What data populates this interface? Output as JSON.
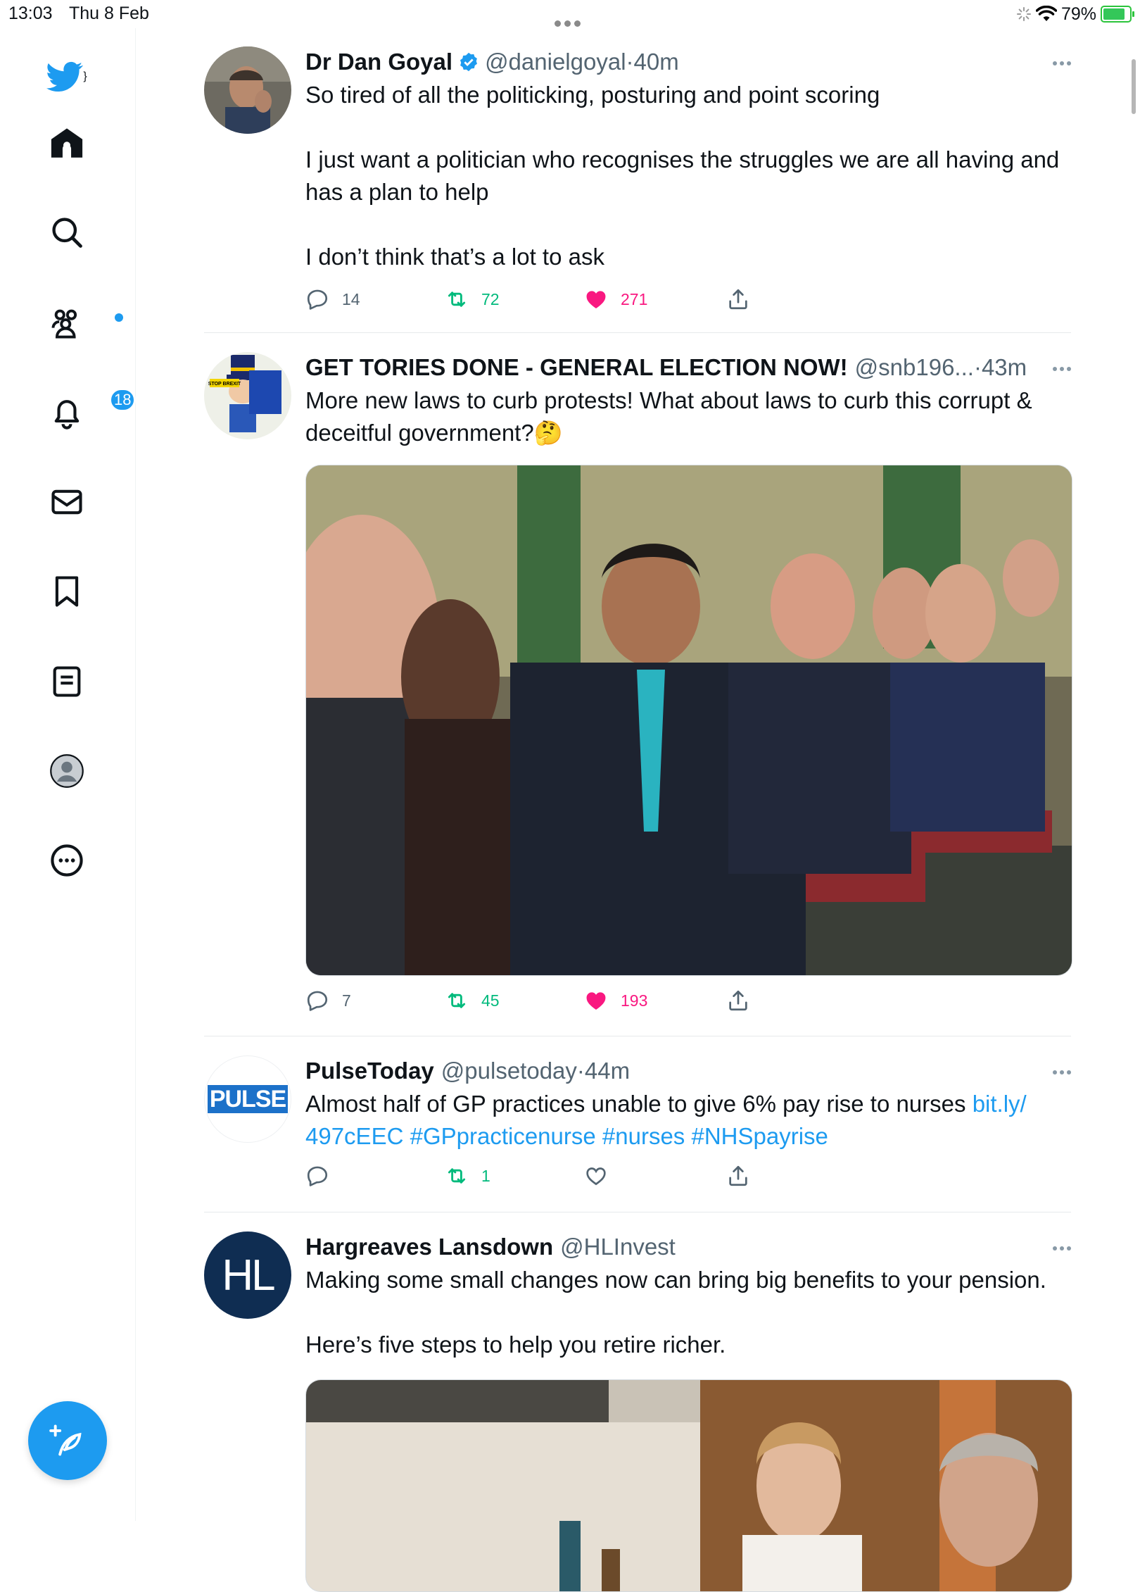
{
  "status_bar": {
    "time": "13:03",
    "date": "Thu 8 Feb",
    "battery": "79%"
  },
  "sidebar": {
    "items": [
      {
        "name": "home",
        "icon": "home-icon"
      },
      {
        "name": "explore",
        "icon": "search-icon"
      },
      {
        "name": "communities",
        "icon": "communities-icon"
      },
      {
        "name": "notifications",
        "icon": "bell-icon",
        "badge": "18"
      },
      {
        "name": "messages",
        "icon": "envelope-icon"
      },
      {
        "name": "bookmarks",
        "icon": "bookmark-icon"
      },
      {
        "name": "lists",
        "icon": "lists-icon"
      },
      {
        "name": "profile",
        "icon": "profile-icon"
      },
      {
        "name": "more",
        "icon": "more-circle-icon"
      }
    ],
    "notifications_badge": "18"
  },
  "tweets": [
    {
      "name": "Dr Dan Goyal",
      "verified": true,
      "handle": "@danielgoyal",
      "time": "40m",
      "text": "So tired of all the politicking, posturing and point scoring\n\nI just want a politician who recognises the struggles we are all having and has a plan to help\n\nI don’t think that’s a lot to ask",
      "replies": "14",
      "retweets": "72",
      "likes": "271",
      "liked": true
    },
    {
      "name": "GET TORIES DONE - GENERAL ELECTION NOW!",
      "handle": "@snb196...",
      "time": "43m",
      "text": "More new laws to curb protests! What about laws to curb this corrupt & deceitful government?🤔",
      "replies": "7",
      "retweets": "45",
      "likes": "193",
      "liked": true,
      "avatar_sign_text": "STOP BREXIT"
    },
    {
      "name": "PulseToday",
      "handle": "@pulsetoday",
      "time": "44m",
      "text": "Almost half of GP practices unable to give 6% pay rise to nurses ",
      "links": [
        "bit.ly/\n497cEEC",
        "#GPpracticenurse",
        "#nurses",
        "#NHSpayrise"
      ],
      "avatar_text": "PULSE",
      "replies": "",
      "retweets": "1",
      "likes": "",
      "liked": false
    },
    {
      "name": "Hargreaves Lansdown",
      "handle": "@HLInvest",
      "time": "",
      "text": "Making some small changes now can bring big benefits to your pension.\n\nHere’s five steps to help you retire richer.",
      "avatar_text": "HL"
    }
  ],
  "colors": {
    "accent": "#1d9bf0",
    "retweet": "#00ba7c",
    "like": "#f91880",
    "secondary_text": "#536471"
  }
}
